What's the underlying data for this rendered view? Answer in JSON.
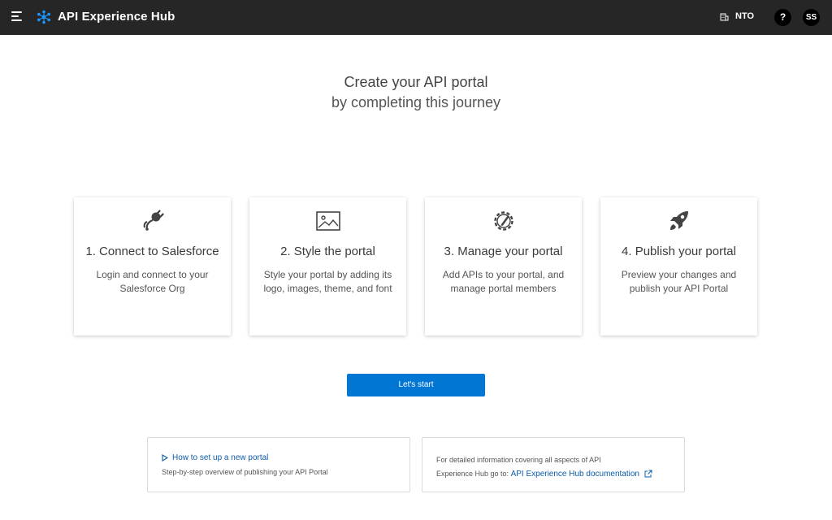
{
  "header": {
    "app_title": "API Experience Hub",
    "org_label": "NTO",
    "help_label": "?",
    "avatar_initials": "SS"
  },
  "intro": {
    "title": "Create your API portal",
    "subtitle": "by completing this journey"
  },
  "steps": [
    {
      "icon": "plug-icon",
      "title": "1. Connect to Salesforce",
      "description": "Login and connect to your Salesforce Org"
    },
    {
      "icon": "image-icon",
      "title": "2. Style the portal",
      "description": "Style your portal by adding its logo, images, theme, and font"
    },
    {
      "icon": "gear-edit-icon",
      "title": "3. Manage your portal",
      "description": "Add APIs to your portal, and manage portal members"
    },
    {
      "icon": "rocket-icon",
      "title": "4. Publish your portal",
      "description": "Preview your changes and publish your API Portal"
    }
  ],
  "start_button": {
    "label": "Let's start"
  },
  "help_links": {
    "setup_link": "How to set up a new portal",
    "setup_desc": "Step-by-step overview of publishing your API Portal",
    "docs_text_1": "For detailed information covering all aspects of API",
    "docs_text_2": "Experience Hub go to: ",
    "docs_link": "API Experience Hub documentation"
  },
  "colors": {
    "topbar": "#262626",
    "accent": "#0176d3",
    "link": "#0b5cab"
  }
}
